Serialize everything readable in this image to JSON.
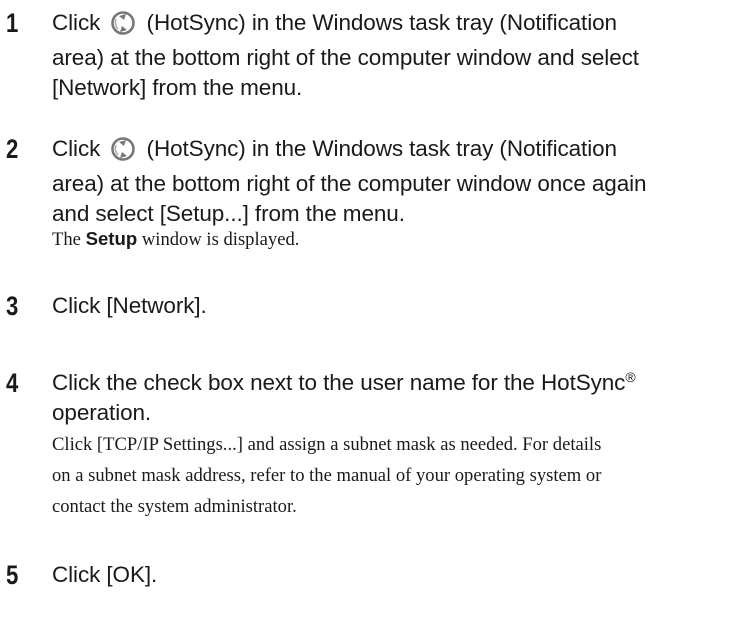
{
  "steps": [
    {
      "number": "1",
      "pre": "Click ",
      "icon": "hotsync-icon",
      "post_line1": " (HotSync) in the Windows task tray (Notification",
      "line2": "area) at the bottom right of the computer window and select",
      "line3": "[Network] from the menu."
    },
    {
      "number": "2",
      "pre": "Click ",
      "icon": "hotsync-icon",
      "post_line1": " (HotSync) in the Windows task tray (Notification",
      "line2": "area) at the bottom right of the computer window once again",
      "line3": "and select [Setup...] from the menu.",
      "note_pre": "The ",
      "note_bold": "Setup",
      "note_post": " window is displayed."
    },
    {
      "number": "3",
      "line1": "Click [Network]."
    },
    {
      "number": "4",
      "line1_pre": "Click the check box next to the user name for the HotSync",
      "line1_sup": "®",
      "line2": "operation.",
      "note_line1": "Click [TCP/IP Settings...] and assign a subnet mask as needed. For details",
      "note_line2": "on a subnet mask address, refer to the manual of your operating system or",
      "note_line3": "contact the system administrator."
    },
    {
      "number": "5",
      "line1": "Click [OK]."
    }
  ]
}
